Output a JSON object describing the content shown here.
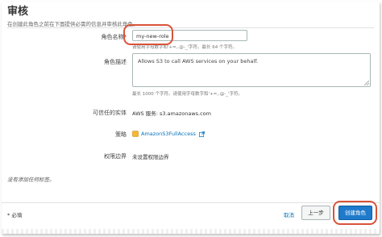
{
  "section": {
    "title": "审核",
    "subtitle": "在创建此角色之前在下面提供必需的信息并审核此角色。"
  },
  "form": {
    "role_name": {
      "label": "角色名称",
      "required_mark": "*",
      "value": "my-new-role",
      "help": "请使用字母数字和'+=,.@-_'字符。最长 64 个字符。"
    },
    "role_description": {
      "label": "角色描述",
      "value": "Allows S3 to call AWS services on your behalf.",
      "help": "最长 1000 个字符。请使用字母数字和'+=,.@-_'字符。"
    },
    "trusted_entity": {
      "label": "可信任的实体",
      "value": "AWS 服务: s3.amazonaws.com"
    },
    "policies": {
      "label": "策略",
      "link": "AmazonS3FullAccess"
    },
    "permissions_boundary": {
      "label": "权限边界",
      "value": "未设置权限边界"
    }
  },
  "tags_note": "没有添加任何标签。",
  "footer": {
    "required_note": "* 必填",
    "cancel_label": "取消",
    "previous_label": "上一步",
    "create_label": "创建角色"
  },
  "colors": {
    "accent_link": "#0073bb",
    "primary_button": "#1f7acb",
    "highlight_ring": "#d9533a",
    "required_star": "#d0021b"
  }
}
